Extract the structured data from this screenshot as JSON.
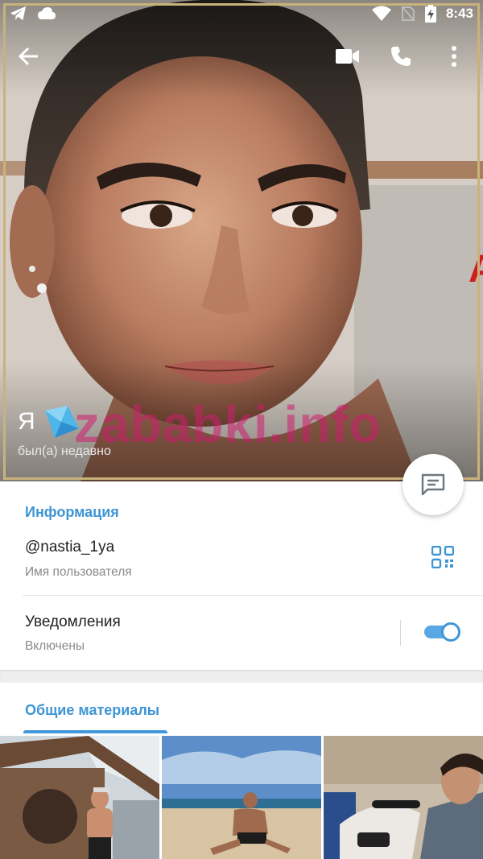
{
  "status_bar": {
    "time": "8:43",
    "left_icons": [
      "telegram-icon",
      "cloud-icon"
    ],
    "right_icons": [
      "wifi-icon",
      "no-sim-icon",
      "battery-charging-icon"
    ]
  },
  "toolbar": {
    "back_icon": "arrow-back-icon",
    "actions": [
      "video-call-icon",
      "phone-icon",
      "more-vert-icon"
    ]
  },
  "profile": {
    "name": "Я",
    "emoji_icon": "diamond-icon",
    "status": "был(а) недавно",
    "watermark": "zababki.info"
  },
  "info": {
    "section_title": "Информация",
    "username": "@nastia_1ya",
    "username_label": "Имя пользователя",
    "notifications_title": "Уведомления",
    "notifications_value": "Включены",
    "notifications_enabled": true
  },
  "media": {
    "tab_label": "Общие материалы",
    "thumbnails": [
      "sauna-photo",
      "beach-photo",
      "selfie-photo"
    ]
  },
  "colors": {
    "accent": "#3d95d4",
    "toggle": "#5aa7e3",
    "watermark": "#cd1e6e"
  }
}
